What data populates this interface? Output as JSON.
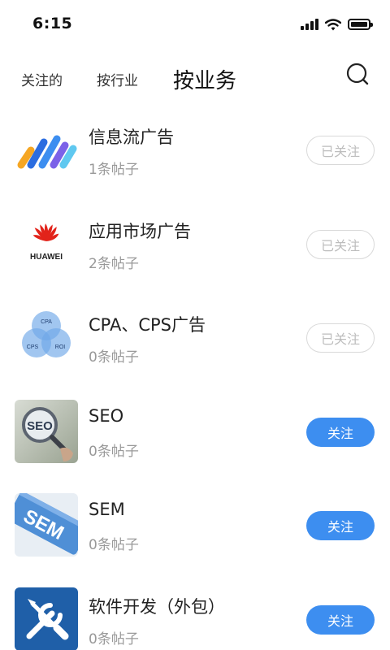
{
  "status_bar": {
    "time": "6:15"
  },
  "tabs": [
    {
      "label": "关注的"
    },
    {
      "label": "按行业"
    },
    {
      "label": "按业务"
    }
  ],
  "colors": {
    "accent": "#3d8ef0",
    "followed_border": "#d9d9d9",
    "muted_text": "#999999"
  },
  "items": [
    {
      "title": "信息流广告",
      "count": "1条帖子",
      "action": "已关注",
      "icon": "feed-ads-logo-icon"
    },
    {
      "title": "应用市场广告",
      "count": "2条帖子",
      "action": "已关注",
      "icon": "huawei-logo-icon",
      "logo_text": "HUAWEI"
    },
    {
      "title": "CPA、CPS广告",
      "count": "0条帖子",
      "action": "已关注",
      "icon": "cpa-cps-roi-venn-icon",
      "logo_labels": [
        "CPA",
        "CPS",
        "ROI"
      ]
    },
    {
      "title": "SEO",
      "count": "0条帖子",
      "action": "关注",
      "icon": "seo-magnifier-photo-icon",
      "logo_text": "SEO"
    },
    {
      "title": "SEM",
      "count": "0条帖子",
      "action": "关注",
      "icon": "sem-key-photo-icon",
      "logo_text": "SEM"
    },
    {
      "title": "软件开发（外包）",
      "count": "0条帖子",
      "action": "关注",
      "icon": "tools-wrench-screwdriver-icon"
    }
  ]
}
